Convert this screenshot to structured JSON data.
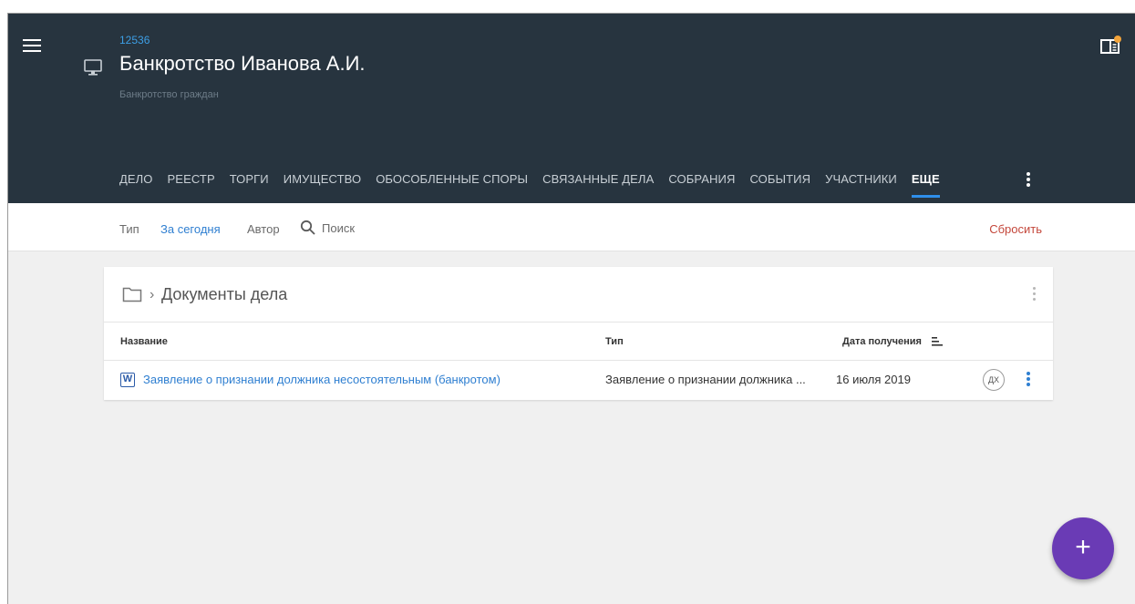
{
  "header": {
    "case_id": "12536",
    "title": "Банкротство Иванова А.И.",
    "subtitle": "Банкротство граждан"
  },
  "tabs": [
    {
      "label": "ДЕЛО",
      "active": false
    },
    {
      "label": "РЕЕСТР",
      "active": false
    },
    {
      "label": "ТОРГИ",
      "active": false
    },
    {
      "label": "ИМУЩЕСТВО",
      "active": false
    },
    {
      "label": "ОБОСОБЛЕННЫЕ СПОРЫ",
      "active": false
    },
    {
      "label": "СВЯЗАННЫЕ ДЕЛА",
      "active": false
    },
    {
      "label": "СОБРАНИЯ",
      "active": false
    },
    {
      "label": "СОБЫТИЯ",
      "active": false
    },
    {
      "label": "УЧАСТНИКИ",
      "active": false
    },
    {
      "label": "ЕЩЕ",
      "active": true
    }
  ],
  "filters": {
    "type": "Тип",
    "today": "За сегодня",
    "author": "Автор",
    "search_placeholder": "Поиск",
    "reset": "Сбросить"
  },
  "folder": {
    "title": "Документы дела",
    "separator": "›"
  },
  "table": {
    "columns": {
      "name": "Название",
      "type": "Тип",
      "date": "Дата получения"
    },
    "rows": [
      {
        "file_icon": "W",
        "name": "Заявление о признании должника несостоятельным (банкротом)",
        "type": "Заявление о признании должника ...",
        "date": "16 июля 2019",
        "author_initials": "ДХ"
      }
    ]
  },
  "fab": {
    "label": "+"
  },
  "colors": {
    "header_bg": "#27343f",
    "accent": "#2f7fd1",
    "tab_indicator": "#2f8fea",
    "reset": "#c4473b",
    "fab": "#6a3bb5",
    "notification_dot": "#f2a33a"
  }
}
